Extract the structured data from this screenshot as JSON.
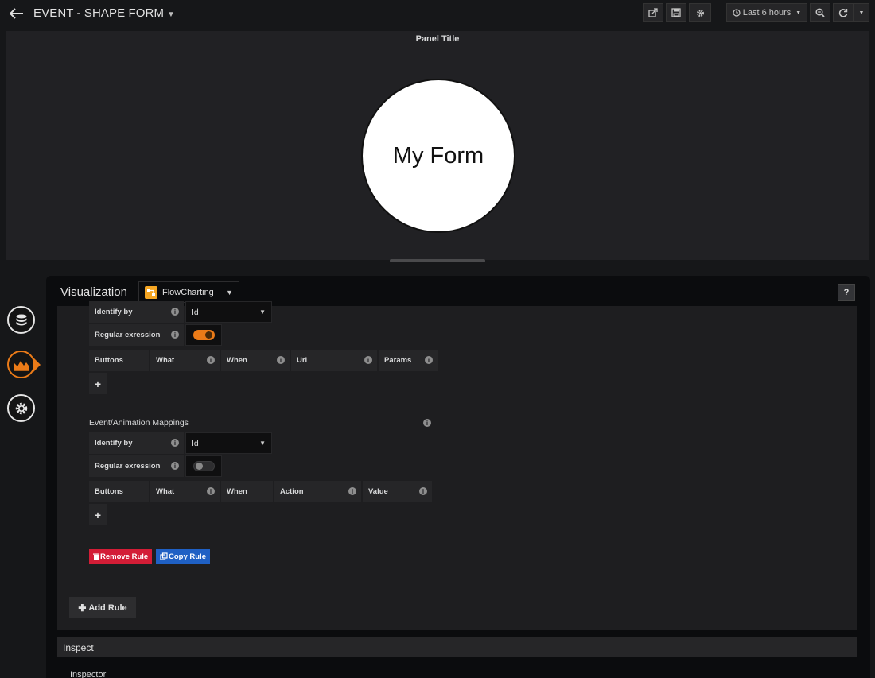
{
  "navbar": {
    "title": "EVENT - SHAPE FORM",
    "time_range": "Last 6 hours",
    "icons": [
      "back-arrow-icon",
      "share-icon",
      "save-icon",
      "gear-icon",
      "clock-icon",
      "zoom-out-icon",
      "refresh-icon",
      "chevron-down-icon"
    ]
  },
  "panel": {
    "title": "Panel Title",
    "shape_text": "My Form"
  },
  "editor": {
    "section_label": "Visualization",
    "plugin_name": "FlowCharting",
    "help_label": "?",
    "link_mappings": {
      "identify_by_label": "Identify by",
      "identify_by_value": "Id",
      "regex_label": "Regular exression",
      "regex_enabled": true,
      "columns": [
        "Buttons",
        "What",
        "When",
        "Url",
        "Params"
      ],
      "add_label": "+"
    },
    "event_mappings": {
      "title": "Event/Animation Mappings",
      "identify_by_label": "Identify by",
      "identify_by_value": "Id",
      "regex_label": "Regular exression",
      "regex_enabled": false,
      "columns": [
        "Buttons",
        "What",
        "When",
        "Action",
        "Value"
      ],
      "add_label": "+"
    },
    "remove_rule": "Remove Rule",
    "copy_rule": "Copy Rule",
    "add_rule": "Add Rule",
    "inspect_title": "Inspect",
    "inspector_label": "Inspector"
  },
  "colors": {
    "accent": "#eb7b18",
    "danger": "#d31d36",
    "primary": "#1f60c4"
  }
}
